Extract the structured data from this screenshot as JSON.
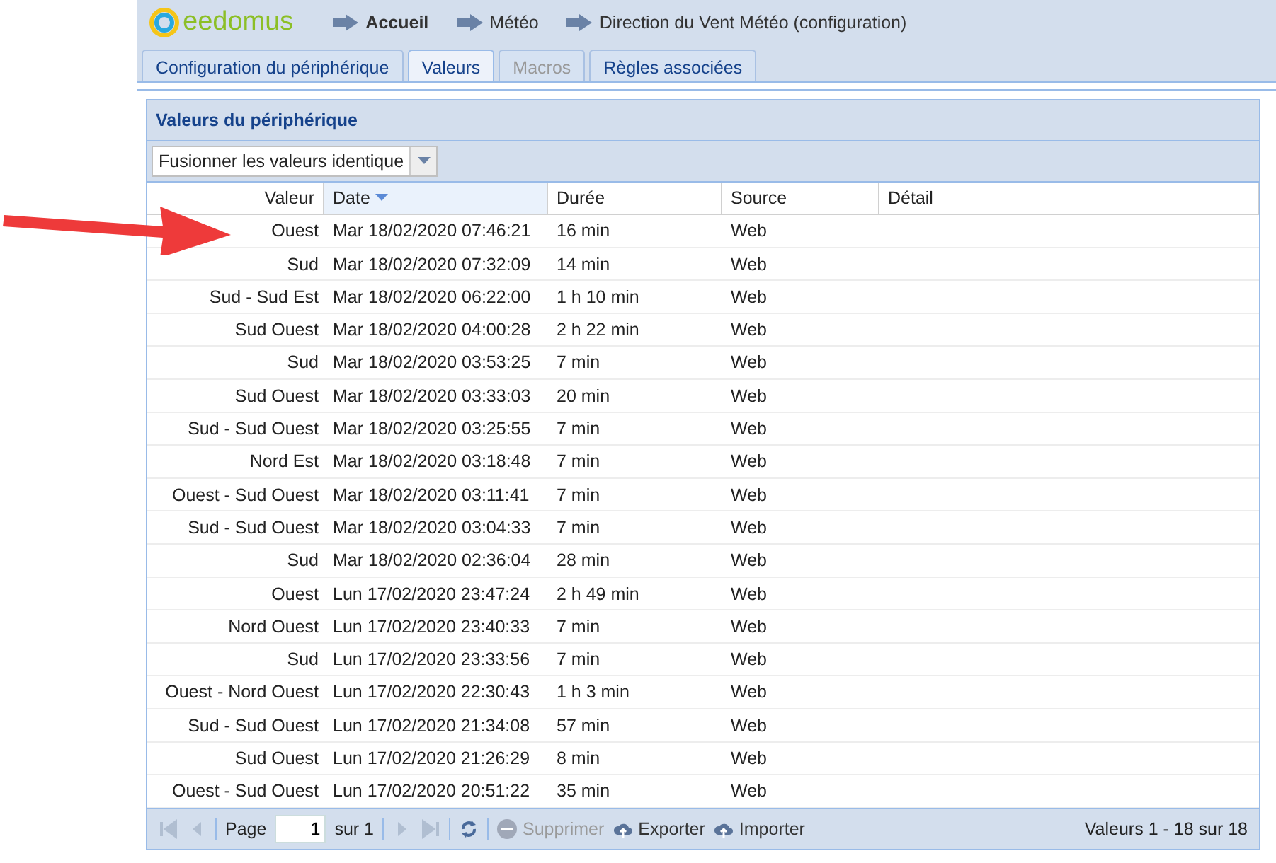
{
  "header": {
    "logo": "eedomus",
    "breadcrumb": [
      {
        "label": "Accueil",
        "bold": true
      },
      {
        "label": "Météo",
        "bold": false
      },
      {
        "label": "Direction du Vent Météo (configuration)",
        "bold": false
      }
    ]
  },
  "tabs": [
    {
      "label": "Configuration du périphérique",
      "selected": false,
      "disabled": false
    },
    {
      "label": "Valeurs",
      "selected": true,
      "disabled": false
    },
    {
      "label": "Macros",
      "selected": false,
      "disabled": true
    },
    {
      "label": "Règles associées",
      "selected": false,
      "disabled": false
    }
  ],
  "panel": {
    "title": "Valeurs du périphérique",
    "filter": {
      "value": "Fusionner les valeurs identique"
    },
    "table": {
      "columns": [
        {
          "label": "Valeur",
          "sorted": false
        },
        {
          "label": "Date",
          "sorted": true
        },
        {
          "label": "Durée",
          "sorted": false
        },
        {
          "label": "Source",
          "sorted": false
        },
        {
          "label": "Détail",
          "sorted": false
        }
      ],
      "rows": [
        [
          "Ouest",
          "Mar 18/02/2020 07:46:21",
          "16 min",
          "Web"
        ],
        [
          "Sud",
          "Mar 18/02/2020 07:32:09",
          "14 min",
          "Web"
        ],
        [
          "Sud - Sud Est",
          "Mar 18/02/2020 06:22:00",
          "1 h 10 min",
          "Web"
        ],
        [
          "Sud Ouest",
          "Mar 18/02/2020 04:00:28",
          "2 h 22 min",
          "Web"
        ],
        [
          "Sud",
          "Mar 18/02/2020 03:53:25",
          "7 min",
          "Web"
        ],
        [
          "Sud Ouest",
          "Mar 18/02/2020 03:33:03",
          "20 min",
          "Web"
        ],
        [
          "Sud - Sud Ouest",
          "Mar 18/02/2020 03:25:55",
          "7 min",
          "Web"
        ],
        [
          "Nord Est",
          "Mar 18/02/2020 03:18:48",
          "7 min",
          "Web"
        ],
        [
          "Ouest - Sud Ouest",
          "Mar 18/02/2020 03:11:41",
          "7 min",
          "Web"
        ],
        [
          "Sud - Sud Ouest",
          "Mar 18/02/2020 03:04:33",
          "7 min",
          "Web"
        ],
        [
          "Sud",
          "Mar 18/02/2020 02:36:04",
          "28 min",
          "Web"
        ],
        [
          "Ouest",
          "Lun 17/02/2020 23:47:24",
          "2 h 49 min",
          "Web"
        ],
        [
          "Nord Ouest",
          "Lun 17/02/2020 23:40:33",
          "7 min",
          "Web"
        ],
        [
          "Sud",
          "Lun 17/02/2020 23:33:56",
          "7 min",
          "Web"
        ],
        [
          "Ouest - Nord Ouest",
          "Lun 17/02/2020 22:30:43",
          "1 h 3 min",
          "Web"
        ],
        [
          "Sud - Sud Ouest",
          "Lun 17/02/2020 21:34:08",
          "57 min",
          "Web"
        ],
        [
          "Sud Ouest",
          "Lun 17/02/2020 21:26:29",
          "8 min",
          "Web"
        ],
        [
          "Ouest - Sud Ouest",
          "Lun 17/02/2020 20:51:22",
          "35 min",
          "Web"
        ]
      ]
    },
    "pager": {
      "page_label": "Page",
      "page": "1",
      "of": "sur 1",
      "summary": "Valeurs 1 - 18 sur 18",
      "tools": [
        {
          "kind": "first",
          "disabled": true
        },
        {
          "kind": "prev",
          "disabled": true
        },
        {
          "kind": "pagefield"
        },
        {
          "kind": "next",
          "disabled": true
        },
        {
          "kind": "last",
          "disabled": true
        },
        {
          "kind": "refresh",
          "disabled": false
        },
        {
          "kind": "delete",
          "label": "Supprimer",
          "disabled": true
        },
        {
          "kind": "export",
          "label": "Exporter",
          "disabled": false
        },
        {
          "kind": "import",
          "label": "Importer",
          "disabled": false
        }
      ]
    }
  },
  "annotation": {
    "kind": "arrow"
  }
}
